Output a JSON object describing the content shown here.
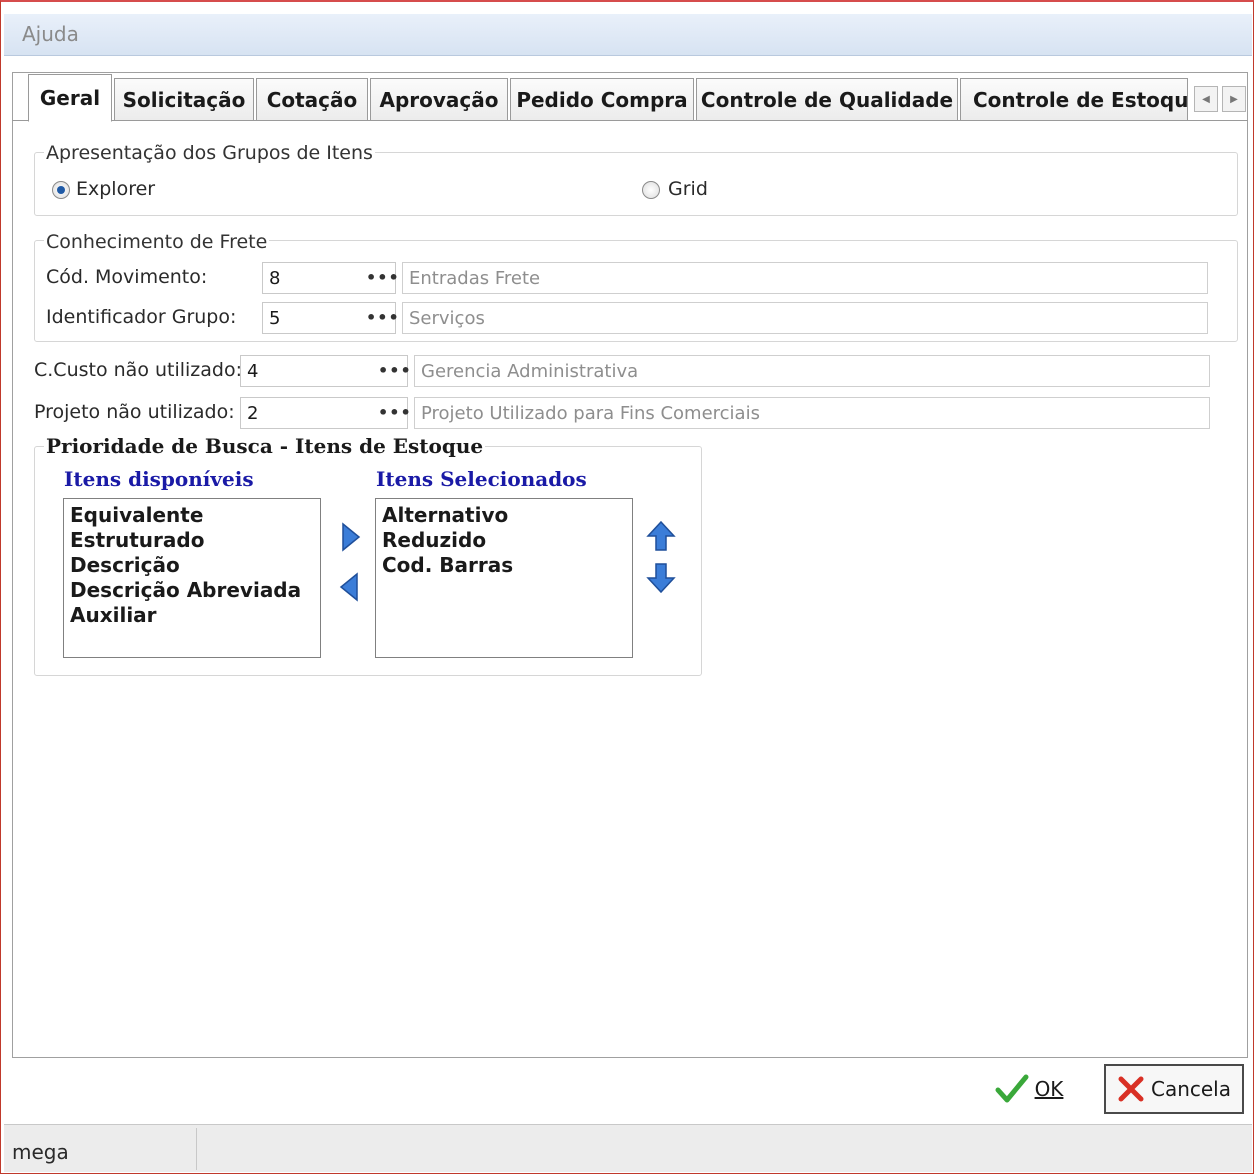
{
  "window": {
    "title": "Ajuda"
  },
  "tabs": [
    {
      "label": "Geral"
    },
    {
      "label": "Solicitação"
    },
    {
      "label": "Cotação"
    },
    {
      "label": "Aprovação"
    },
    {
      "label": "Pedido Compra"
    },
    {
      "label": "Controle de Qualidade"
    },
    {
      "label": "Controle de Estoque"
    }
  ],
  "grupos": {
    "legend": "Apresentação dos Grupos de Itens",
    "explorer_label": "Explorer",
    "grid_label": "Grid",
    "selected": "Explorer"
  },
  "frete": {
    "legend": "Conhecimento de Frete",
    "movimento_label": "Cód. Movimento:",
    "movimento_value": "8",
    "movimento_desc": "Entradas Frete",
    "grupo_label": "Identificador Grupo:",
    "grupo_value": "5",
    "grupo_desc": "Serviços"
  },
  "custo": {
    "label": "C.Custo não utilizado:",
    "value": "4",
    "desc": "Gerencia Administrativa"
  },
  "projeto": {
    "label": "Projeto não utilizado:",
    "value": "2",
    "desc": "Projeto Utilizado para Fins Comerciais"
  },
  "prioridade": {
    "legend": "Prioridade de Busca - Itens de Estoque",
    "disponiveis_title": "Itens disponíveis",
    "selecionados_title": "Itens Selecionados",
    "disponiveis": [
      "Equivalente",
      "Estruturado",
      "Descrição",
      "Descrição Abreviada",
      "Auxiliar"
    ],
    "selecionados": [
      "Alternativo",
      "Reduzido",
      "Cod. Barras"
    ]
  },
  "buttons": {
    "ok": "OK",
    "cancel": "Cancela"
  },
  "status": {
    "text": "mega"
  },
  "lookup_dots": "•••",
  "colors": {
    "accent_blue": "#1a1aa6",
    "arrow_blue": "#3b7dd8"
  }
}
